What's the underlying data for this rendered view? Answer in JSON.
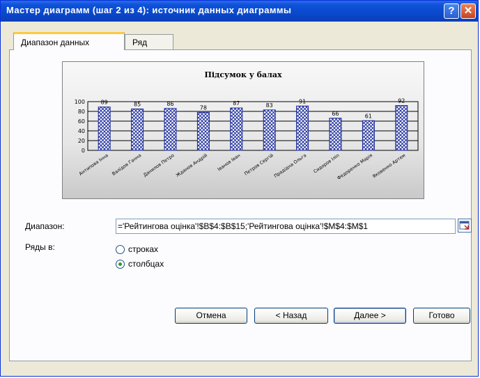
{
  "window": {
    "title": "Мастер диаграмм (шаг 2 из 4): источник данных диаграммы",
    "help_glyph": "?",
    "close_glyph": "✕"
  },
  "tabs": [
    {
      "label": "Диапазон данных",
      "active": true
    },
    {
      "label": "Ряд",
      "active": false
    }
  ],
  "chart_data": {
    "type": "bar",
    "title": "Підсумок у балах",
    "categories": [
      "Антипова Інна",
      "Валідов Ганна",
      "Данилов Петро",
      "Жданов Андрій",
      "Іванов Іван",
      "Петров Сергій",
      "Прадідна Ольга",
      "Сидоров Іліп",
      "Федоренко Марія",
      "Яковенко Артем"
    ],
    "values": [
      89,
      85,
      86,
      78,
      87,
      83,
      91,
      66,
      61,
      92
    ],
    "y_ticks": [
      "0",
      "20",
      "40",
      "60",
      "80",
      "100"
    ],
    "ylim": [
      0,
      100
    ],
    "grid": true,
    "bar_pattern": "blue-crosshatch"
  },
  "form": {
    "range_label": "Диапазон:",
    "range_value": "='Рейтингова оцінка'!$B$4:$B$15;'Рейтингова оцінка'!$M$4:$M$1",
    "series_in_label": "Ряды в:",
    "option_rows": "строках",
    "option_cols": "столбцах",
    "selected": "столбцах"
  },
  "buttons": {
    "cancel": "Отмена",
    "back": "< Назад",
    "next": "Далее >",
    "finish": "Готово"
  }
}
